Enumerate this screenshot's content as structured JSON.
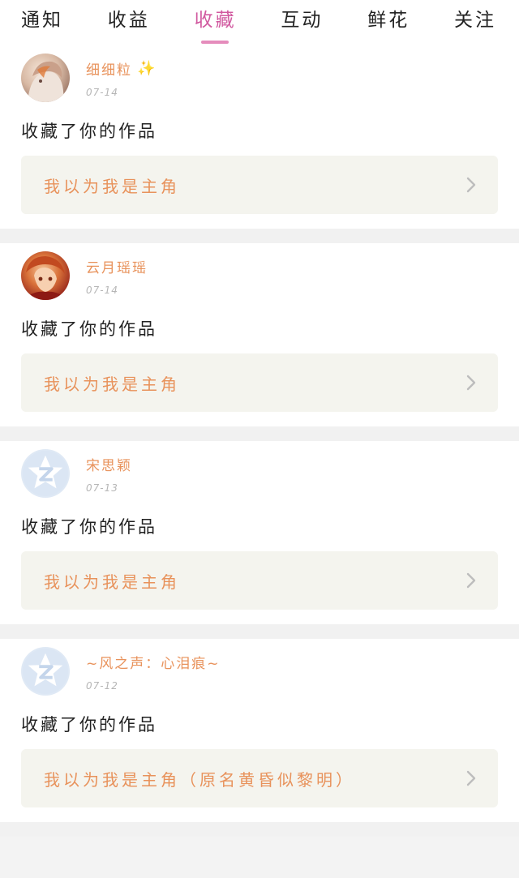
{
  "tabs": [
    {
      "label": "通知",
      "active": false
    },
    {
      "label": "收益",
      "active": false
    },
    {
      "label": "收藏",
      "active": true
    },
    {
      "label": "互动",
      "active": false
    },
    {
      "label": "鲜花",
      "active": false
    },
    {
      "label": "关注",
      "active": false
    }
  ],
  "colors": {
    "active_tab": "#d15aa0",
    "accent_orange": "#e8925b",
    "work_box_bg": "#f4f4ee"
  },
  "items": [
    {
      "username": "细细粒",
      "badge_icon": "sparkle-icon",
      "date": "07-14",
      "action": "收藏了你的作品",
      "work_title": "我以为我是主角",
      "avatar": "avatar-illustration-light"
    },
    {
      "username": "云月瑶瑶",
      "date": "07-14",
      "action": "收藏了你的作品",
      "work_title": "我以为我是主角",
      "avatar": "avatar-illustration-red"
    },
    {
      "username": "宋思颖",
      "date": "07-13",
      "action": "收藏了你的作品",
      "work_title": "我以为我是主角",
      "avatar": "avatar-default-qzone"
    },
    {
      "username": "~风之声：心泪痕~",
      "date": "07-12",
      "action": "收藏了你的作品",
      "work_title": "我以为我是主角（原名黄昏似黎明）",
      "avatar": "avatar-default-qzone"
    }
  ]
}
